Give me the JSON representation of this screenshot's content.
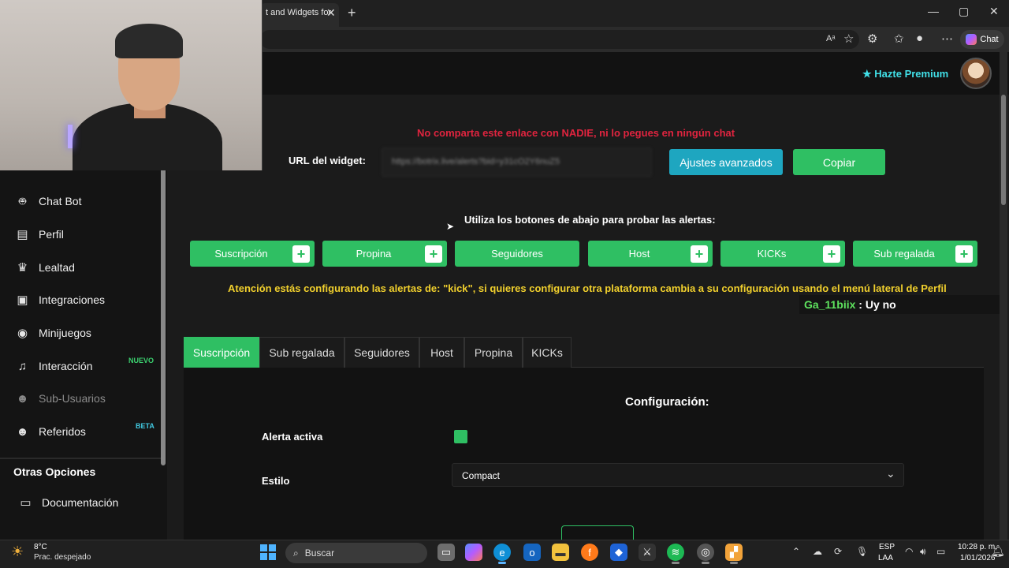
{
  "browser": {
    "tab_title": "t and Widgets for",
    "new_tab": "+",
    "close_tab": "✕",
    "window_controls": {
      "minimize": "—",
      "maximize": "▢",
      "close": "✕"
    },
    "chat_label": "Chat"
  },
  "header": {
    "premium_label": "Hazte Premium",
    "premium_icon": "star-icon"
  },
  "sidebar": {
    "items": [
      {
        "label": "Chat Bot",
        "icon": "robot-icon"
      },
      {
        "label": "Perfil",
        "icon": "id-card-icon"
      },
      {
        "label": "Lealtad",
        "icon": "trophy-icon"
      },
      {
        "label": "Integraciones",
        "icon": "integrations-icon"
      },
      {
        "label": "Minijuegos",
        "icon": "gamepad-icon"
      },
      {
        "label": "Interacción",
        "icon": "music-icon"
      },
      {
        "label": "Sub-Usuarios",
        "icon": "users-icon"
      },
      {
        "label": "Referidos",
        "icon": "referral-icon"
      }
    ],
    "badge_nuevo": "NUEVO",
    "badge_beta": "BETA",
    "otras_title": "Otras Opciones",
    "documentacion": "Documentación"
  },
  "widget": {
    "warning": "No comparta este enlace con NADIE, ni lo pegues en ningún chat",
    "url_label": "URL del widget:",
    "url_value": "https://botrix.live/alerts?bid=y31cO2Y6nuZ5",
    "ajustes_label": "Ajustes avanzados",
    "copiar_label": "Copiar",
    "test_label": "Utiliza los botones de abajo para probar las alertas:",
    "test_buttons": [
      "Suscripción",
      "Propina",
      "Seguidores",
      "Host",
      "KICKs",
      "Sub regalada"
    ],
    "platform_warning": "Atención estás configurando las alertas de: \"kick\", si quieres configurar otra plataforma cambia a su configuración usando el menú lateral de Perfil"
  },
  "chat_overlay": {
    "user": "Ga_11biix",
    "message": " : Uy no"
  },
  "tabs": [
    "Suscripción",
    "Sub regalada",
    "Seguidores",
    "Host",
    "Propina",
    "KICKs"
  ],
  "config": {
    "title": "Configuración:",
    "alerta_label": "Alerta activa",
    "alerta_checked": true,
    "estilo_label": "Estilo",
    "estilo_value": "Compact"
  },
  "taskbar": {
    "temp": "8°C",
    "weather": "Prac. despejado",
    "search": "Buscar",
    "lang1": "ESP",
    "lang2": "LAA",
    "time": "10:28 p. m.",
    "date": "1/01/2026"
  },
  "colors": {
    "accent_green": "#2fbf63",
    "accent_cyan": "#1ea6c0",
    "warning_red": "#e0243f",
    "warning_yellow": "#f0cf2d"
  }
}
